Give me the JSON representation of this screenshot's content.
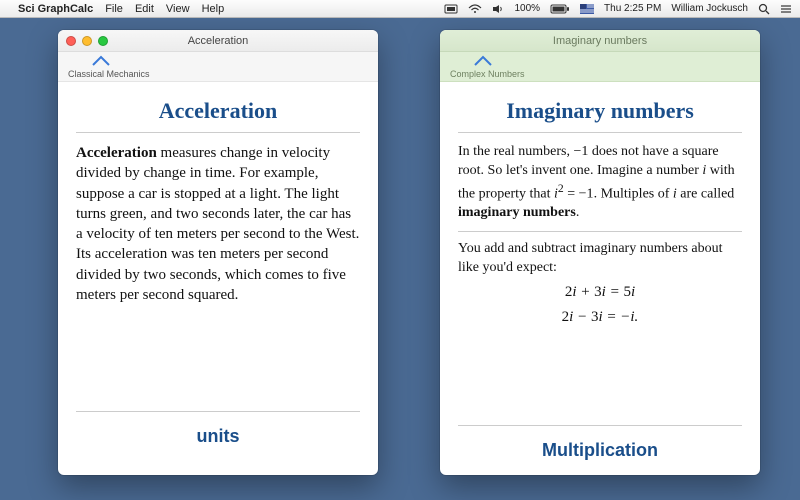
{
  "menubar": {
    "apple": "",
    "appname": "Sci GraphCalc",
    "items": [
      "File",
      "Edit",
      "View",
      "Help"
    ],
    "right": {
      "battery_pct": "100%",
      "battery_icon": "battery",
      "time": "Thu 2:25 PM",
      "user": "William Jockusch"
    }
  },
  "windows": {
    "left": {
      "title": "Acceleration",
      "breadcrumb": "Classical Mechanics",
      "heading": "Acceleration",
      "body_html": "<b>Acceleration</b> measures change in velocity divided by change in time. For example, suppose a car is stopped at a light. The light turns green, and two seconds later, the car has a velocity of ten meters per second to the West. Its acceleration was ten meters per second divided by two seconds, which comes to five meters per second squared.",
      "next_section": "units"
    },
    "right": {
      "title": "Imaginary numbers",
      "breadcrumb": "Complex Numbers",
      "heading": "Imaginary numbers",
      "para1_html": "In the real numbers, <span class='num'>−1</span> does not have a square root. So let's invent one. Imagine a number <span class='eq'>i</span> with the property that <span class='eq'>i</span><sup><span class='num'>2</span></sup> = <span class='num'>−1</span>. Multiples of <span class='eq'>i</span> are called <b>imaginary numbers</b>.",
      "para2": "You add and subtract imaginary numbers about like you'd expect:",
      "math_lines": [
        "2i + 3i = 5i",
        "2i − 3i = −i."
      ],
      "next_section": "Multiplication"
    }
  }
}
